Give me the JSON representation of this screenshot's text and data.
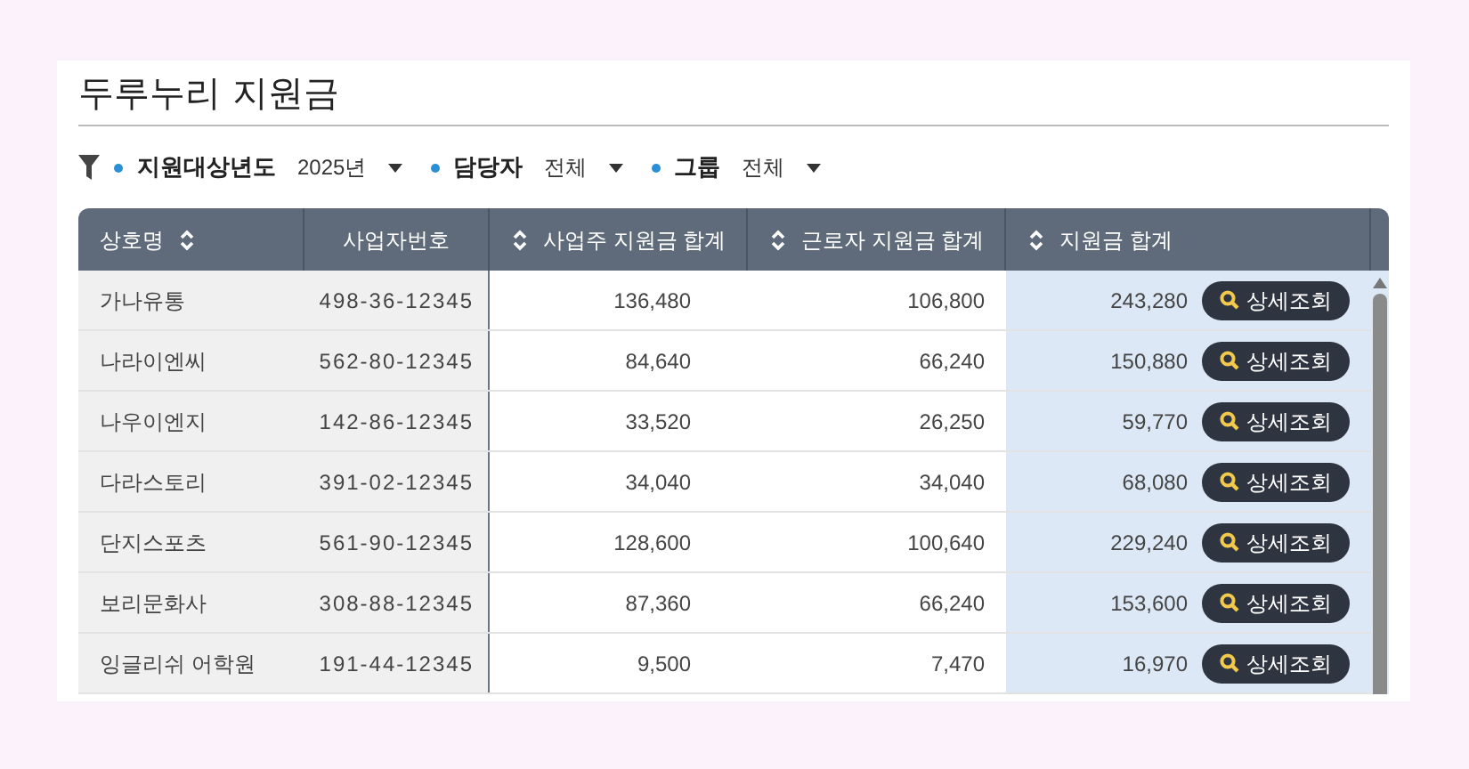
{
  "title": "두루누리 지원금",
  "filters": [
    {
      "label": "지원대상년도",
      "value": "2025년"
    },
    {
      "label": "담당자",
      "value": "전체"
    },
    {
      "label": "그룹",
      "value": "전체"
    }
  ],
  "table": {
    "columns": [
      {
        "label": "상호명",
        "kind": "trailingsort"
      },
      {
        "label": "사업자번호",
        "kind": "plain"
      },
      {
        "label": "사업주 지원금 합계",
        "kind": "leadingsort"
      },
      {
        "label": "근로자 지원금 합계",
        "kind": "leadingsort"
      },
      {
        "label": "지원금 합계",
        "kind": "leadingsort"
      }
    ],
    "rows": [
      {
        "cells": [
          "가나유통",
          "498-36-12345",
          "136,480",
          "106,800",
          "243,280"
        ],
        "button": "상세조회"
      },
      {
        "cells": [
          "나라이엔씨",
          "562-80-12345",
          "84,640",
          "66,240",
          "150,880"
        ],
        "button": "상세조회"
      },
      {
        "cells": [
          "나우이엔지",
          "142-86-12345",
          "33,520",
          "26,250",
          "59,770"
        ],
        "button": "상세조회"
      },
      {
        "cells": [
          "다라스토리",
          "391-02-12345",
          "34,040",
          "34,040",
          "68,080"
        ],
        "button": "상세조회"
      },
      {
        "cells": [
          "단지스포츠",
          "561-90-12345",
          "128,600",
          "100,640",
          "229,240"
        ],
        "button": "상세조회"
      },
      {
        "cells": [
          "보리문화사",
          "308-88-12345",
          "87,360",
          "66,240",
          "153,600"
        ],
        "button": "상세조회"
      },
      {
        "cells": [
          "잉글리쉬 어학원",
          "191-44-12345",
          "9,500",
          "7,470",
          "16,970"
        ],
        "button": "상세조회"
      }
    ]
  }
}
